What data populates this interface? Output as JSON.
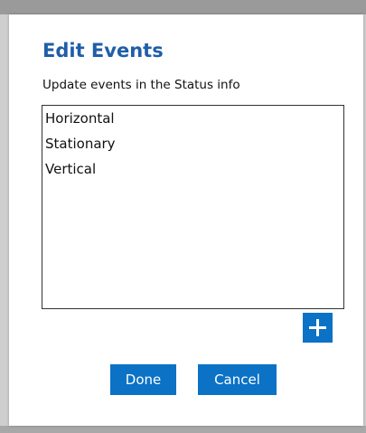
{
  "dialog": {
    "title": "Edit Events",
    "subtitle": "Update events in the Status info",
    "events": [
      "Horizontal",
      "Stationary",
      "Vertical"
    ],
    "add_icon": "plus-icon",
    "done_label": "Done",
    "cancel_label": "Cancel"
  },
  "colors": {
    "accent": "#0b72c6",
    "title": "#1f5ea8"
  }
}
